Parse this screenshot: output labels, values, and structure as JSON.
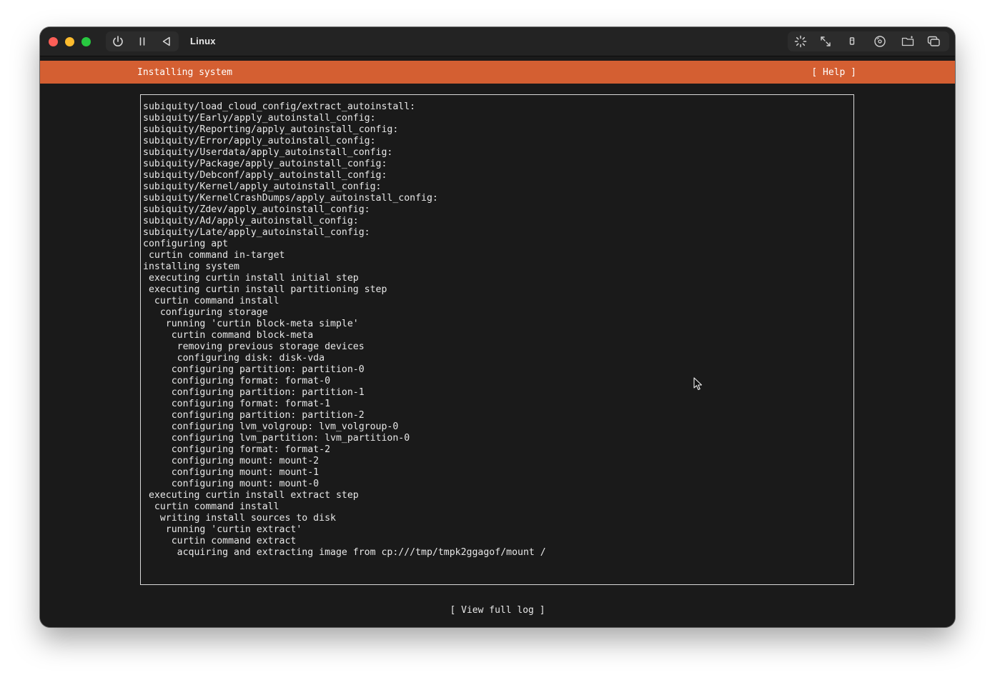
{
  "window": {
    "title": "Linux"
  },
  "toolbar": {
    "controls": [
      "power-icon",
      "pause-icon",
      "back-icon"
    ],
    "tools": [
      "brightness-icon",
      "resize-icon",
      "usb-icon",
      "disc-icon",
      "shared-folder-icon",
      "windows-icon"
    ]
  },
  "header": {
    "title": "Installing system",
    "help_label": "[ Help ]",
    "accent_color": "#d45f32"
  },
  "log": {
    "lines": [
      "subiquity/load_cloud_config/extract_autoinstall:",
      "subiquity/Early/apply_autoinstall_config:",
      "subiquity/Reporting/apply_autoinstall_config:",
      "subiquity/Error/apply_autoinstall_config:",
      "subiquity/Userdata/apply_autoinstall_config:",
      "subiquity/Package/apply_autoinstall_config:",
      "subiquity/Debconf/apply_autoinstall_config:",
      "subiquity/Kernel/apply_autoinstall_config:",
      "subiquity/KernelCrashDumps/apply_autoinstall_config:",
      "subiquity/Zdev/apply_autoinstall_config:",
      "subiquity/Ad/apply_autoinstall_config:",
      "subiquity/Late/apply_autoinstall_config:",
      "configuring apt",
      " curtin command in-target",
      "installing system",
      " executing curtin install initial step",
      " executing curtin install partitioning step",
      "  curtin command install",
      "   configuring storage",
      "    running 'curtin block-meta simple'",
      "     curtin command block-meta",
      "      removing previous storage devices",
      "      configuring disk: disk-vda",
      "     configuring partition: partition-0",
      "     configuring format: format-0",
      "     configuring partition: partition-1",
      "     configuring format: format-1",
      "     configuring partition: partition-2",
      "     configuring lvm_volgroup: lvm_volgroup-0",
      "     configuring lvm_partition: lvm_partition-0",
      "     configuring format: format-2",
      "     configuring mount: mount-2",
      "     configuring mount: mount-1",
      "     configuring mount: mount-0",
      " executing curtin install extract step",
      "  curtin command install",
      "   writing install sources to disk",
      "    running 'curtin extract'",
      "     curtin command extract",
      "      acquiring and extracting image from cp:///tmp/tmpk2ggagof/mount /"
    ]
  },
  "footer": {
    "view_log_label": "[ View full log ]"
  }
}
